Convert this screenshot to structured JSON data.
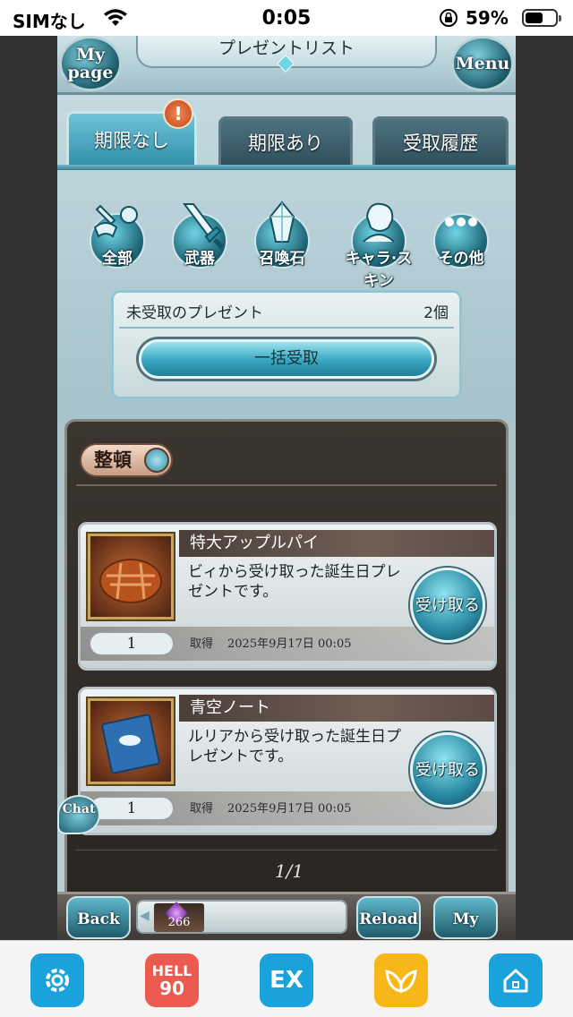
{
  "status_bar": {
    "carrier": "SIMなし",
    "time": "0:05",
    "battery_percent": "59%",
    "battery_level": 0.59
  },
  "header": {
    "title": "プレゼントリスト",
    "left_button": "My page",
    "right_button": "Menu"
  },
  "tabs": [
    {
      "label": "期限なし",
      "active": true,
      "badge": "!"
    },
    {
      "label": "期限あり",
      "active": false
    },
    {
      "label": "受取履歴",
      "active": false
    }
  ],
  "filters": [
    {
      "label": "全部",
      "icon": "all-items-icon"
    },
    {
      "label": "武器",
      "icon": "sword-icon"
    },
    {
      "label": "召喚石",
      "icon": "crystal-icon"
    },
    {
      "label": "キャラ·スキン",
      "icon": "character-icon"
    },
    {
      "label": "その他",
      "icon": "ellipsis-icon"
    }
  ],
  "summary": {
    "label": "未受取のプレゼント",
    "count": "2個",
    "claim_all": "一括受取"
  },
  "sort": {
    "label": "整頓"
  },
  "items": [
    {
      "name": "特大アップルパイ",
      "description": "ビィから受け取った誕生日プレゼントです。",
      "quantity": "1",
      "acquired_label": "取得",
      "date": "2025年9月17日 00:05",
      "claim": "受け取る",
      "thumb_icon": "apple-pie-icon"
    },
    {
      "name": "青空ノート",
      "description": "ルリアから受け取った誕生日プレゼントです。",
      "quantity": "1",
      "acquired_label": "取得",
      "date": "2025年9月17日 00:05",
      "claim": "受け取る",
      "thumb_icon": "notebook-icon"
    }
  ],
  "pager": "1/1",
  "chat": "Chat",
  "game_footer": {
    "back": "Back",
    "crystal_count": "266",
    "reload": "Reload",
    "mypage": "My page"
  },
  "browser_bar": {
    "hell_top": "HELL",
    "hell_num": "90",
    "ex": "EX"
  },
  "colors": {
    "accent": "#2f8ea6",
    "panel_dark": "#2a2521",
    "badge": "#c64413"
  }
}
